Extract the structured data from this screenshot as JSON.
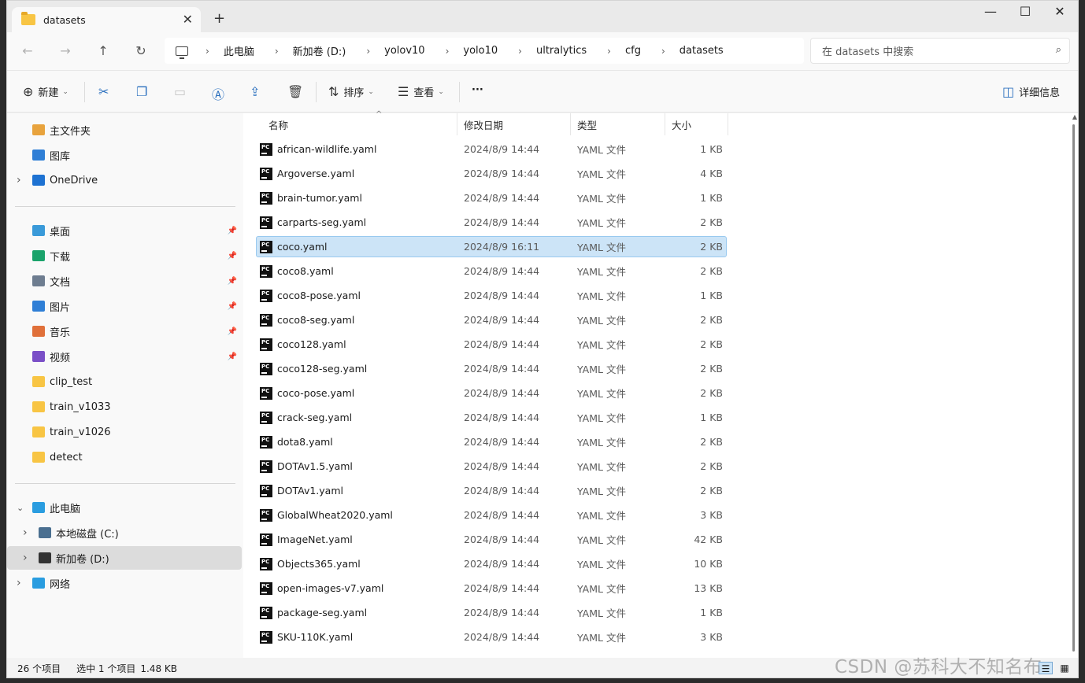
{
  "titlebar": {
    "tab_title": "datasets",
    "tab_close": "✕",
    "new_tab": "+",
    "minimize": "—",
    "maximize": "☐",
    "close": "✕"
  },
  "nav": {
    "back": "←",
    "forward": "→",
    "up": "↑",
    "refresh": "↻"
  },
  "breadcrumb": [
    "此电脑",
    "新加卷 (D:)",
    "yolov10",
    "yolo10",
    "ultralytics",
    "cfg",
    "datasets"
  ],
  "search": {
    "placeholder": "在 datasets 中搜索"
  },
  "toolbar": {
    "new_label": "新建",
    "sort_label": "排序",
    "view_label": "查看",
    "more_label": "···",
    "details_label": "详细信息"
  },
  "sidebar": {
    "top": [
      {
        "label": "主文件夹",
        "icon": "home-icon",
        "color": "#e8a33d"
      },
      {
        "label": "图库",
        "icon": "gallery-icon",
        "color": "#2f7fd6"
      },
      {
        "label": "OneDrive",
        "icon": "cloud-icon",
        "color": "#1e72d2"
      }
    ],
    "quick": [
      {
        "label": "桌面",
        "icon": "desktop-icon",
        "color": "#3a9ad9"
      },
      {
        "label": "下载",
        "icon": "download-icon",
        "color": "#1aa36b"
      },
      {
        "label": "文档",
        "icon": "document-icon",
        "color": "#6e7d90"
      },
      {
        "label": "图片",
        "icon": "pictures-icon",
        "color": "#2f7fd6"
      },
      {
        "label": "音乐",
        "icon": "music-icon",
        "color": "#e0703a"
      },
      {
        "label": "视频",
        "icon": "video-icon",
        "color": "#7a4fc7"
      },
      {
        "label": "clip_test",
        "icon": "folder-icon",
        "color": "#f8c544"
      },
      {
        "label": "train_v1033",
        "icon": "folder-icon",
        "color": "#f8c544"
      },
      {
        "label": "train_v1026",
        "icon": "folder-icon",
        "color": "#f8c544"
      },
      {
        "label": "detect",
        "icon": "folder-icon",
        "color": "#f8c544"
      }
    ],
    "pc": {
      "label": "此电脑",
      "icon": "computer-icon",
      "color": "#2a9de0"
    },
    "drives": [
      {
        "label": "本地磁盘 (C:)",
        "icon": "drive-icon",
        "color": "#4a6f90"
      },
      {
        "label": "新加卷 (D:)",
        "icon": "drive-icon",
        "color": "#333333"
      }
    ],
    "network": {
      "label": "网络",
      "icon": "network-icon",
      "color": "#2a9de0"
    }
  },
  "columns": {
    "name": "名称",
    "date": "修改日期",
    "type": "类型",
    "size": "大小"
  },
  "files": [
    {
      "name": "african-wildlife.yaml",
      "date": "2024/8/9 14:44",
      "type": "YAML 文件",
      "size": "1 KB"
    },
    {
      "name": "Argoverse.yaml",
      "date": "2024/8/9 14:44",
      "type": "YAML 文件",
      "size": "4 KB"
    },
    {
      "name": "brain-tumor.yaml",
      "date": "2024/8/9 14:44",
      "type": "YAML 文件",
      "size": "1 KB"
    },
    {
      "name": "carparts-seg.yaml",
      "date": "2024/8/9 14:44",
      "type": "YAML 文件",
      "size": "2 KB"
    },
    {
      "name": "coco.yaml",
      "date": "2024/8/9 16:11",
      "type": "YAML 文件",
      "size": "2 KB",
      "selected": true
    },
    {
      "name": "coco8.yaml",
      "date": "2024/8/9 14:44",
      "type": "YAML 文件",
      "size": "2 KB"
    },
    {
      "name": "coco8-pose.yaml",
      "date": "2024/8/9 14:44",
      "type": "YAML 文件",
      "size": "1 KB"
    },
    {
      "name": "coco8-seg.yaml",
      "date": "2024/8/9 14:44",
      "type": "YAML 文件",
      "size": "2 KB"
    },
    {
      "name": "coco128.yaml",
      "date": "2024/8/9 14:44",
      "type": "YAML 文件",
      "size": "2 KB"
    },
    {
      "name": "coco128-seg.yaml",
      "date": "2024/8/9 14:44",
      "type": "YAML 文件",
      "size": "2 KB"
    },
    {
      "name": "coco-pose.yaml",
      "date": "2024/8/9 14:44",
      "type": "YAML 文件",
      "size": "2 KB"
    },
    {
      "name": "crack-seg.yaml",
      "date": "2024/8/9 14:44",
      "type": "YAML 文件",
      "size": "1 KB"
    },
    {
      "name": "dota8.yaml",
      "date": "2024/8/9 14:44",
      "type": "YAML 文件",
      "size": "2 KB"
    },
    {
      "name": "DOTAv1.5.yaml",
      "date": "2024/8/9 14:44",
      "type": "YAML 文件",
      "size": "2 KB"
    },
    {
      "name": "DOTAv1.yaml",
      "date": "2024/8/9 14:44",
      "type": "YAML 文件",
      "size": "2 KB"
    },
    {
      "name": "GlobalWheat2020.yaml",
      "date": "2024/8/9 14:44",
      "type": "YAML 文件",
      "size": "3 KB"
    },
    {
      "name": "ImageNet.yaml",
      "date": "2024/8/9 14:44",
      "type": "YAML 文件",
      "size": "42 KB"
    },
    {
      "name": "Objects365.yaml",
      "date": "2024/8/9 14:44",
      "type": "YAML 文件",
      "size": "10 KB"
    },
    {
      "name": "open-images-v7.yaml",
      "date": "2024/8/9 14:44",
      "type": "YAML 文件",
      "size": "13 KB"
    },
    {
      "name": "package-seg.yaml",
      "date": "2024/8/9 14:44",
      "type": "YAML 文件",
      "size": "1 KB"
    },
    {
      "name": "SKU-110K.yaml",
      "date": "2024/8/9 14:44",
      "type": "YAML 文件",
      "size": "3 KB"
    }
  ],
  "file_icon_text": "PC",
  "status": {
    "count": "26 个项目",
    "selected": "选中 1 个项目",
    "size": "1.48 KB"
  },
  "watermark": "CSDN @苏科大不知名布"
}
